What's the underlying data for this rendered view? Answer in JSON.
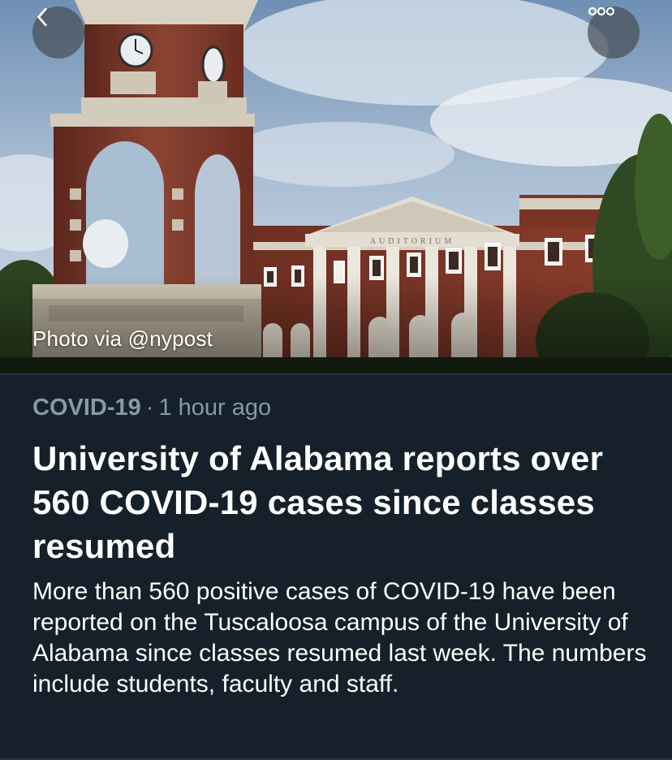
{
  "hero": {
    "caption": "Photo via @nypost",
    "building_inscription": "AUDITORIUM",
    "back_icon": "chevron-left-icon",
    "more_icon": "more-horizontal-icon"
  },
  "article": {
    "topic": "COVID-19",
    "separator": "·",
    "time": "1 hour ago",
    "headline": "University of Alabama reports over 560 COVID-19 cases since classes resumed",
    "summary": "More than 560 positive cases of COVID-19 have been reported on the Tuscaloosa campus of the University of Alabama since classes resumed last week. The numbers include students, faculty and staff."
  },
  "colors": {
    "background": "#15202b",
    "meta_text": "#8899a6",
    "primary_text": "#ffffff"
  }
}
